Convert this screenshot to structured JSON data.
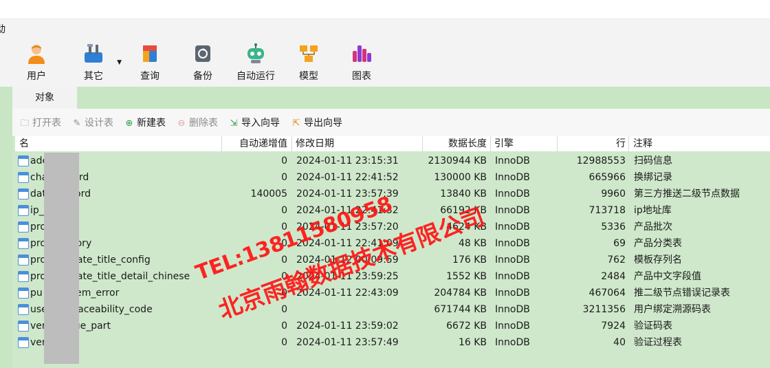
{
  "menubar": {
    "menu_label": "动"
  },
  "ribbon": [
    {
      "label": "用户",
      "icon": "user-icon"
    },
    {
      "label": "其它",
      "icon": "tools-icon"
    },
    {
      "label": "查询",
      "icon": "query-icon"
    },
    {
      "label": "备份",
      "icon": "backup-icon"
    },
    {
      "label": "自动运行",
      "icon": "robot-icon"
    },
    {
      "label": "模型",
      "icon": "model-icon"
    },
    {
      "label": "图表",
      "icon": "chart-icon"
    }
  ],
  "tabs": {
    "objects": "对象"
  },
  "toolbar": {
    "open_table": "打开表",
    "design_table": "设计表",
    "new_table": "新建表",
    "delete_table": "删除表",
    "import_wizard": "导入向导",
    "export_wizard": "导出向导"
  },
  "columns": {
    "name": "名",
    "auto_increment": "自动递增值",
    "modified": "修改日期",
    "data_length": "数据长度",
    "engine": "引擎",
    "rows": "行",
    "comment": "注释"
  },
  "rows": [
    {
      "name": "ade      nfo",
      "auto_inc": "0",
      "modified": "2024-01-11 23:15:31",
      "data_length": "2130944 KB",
      "engine": "InnoDB",
      "rows": "12988553",
      "comment": "扫码信息"
    },
    {
      "name": "cha         l_record",
      "auto_inc": "0",
      "modified": "2024-01-11 22:41:52",
      "data_length": "130000 KB",
      "engine": "InnoDB",
      "rows": "665966",
      "comment": "换绑记录"
    },
    {
      "name": "dat         n_record",
      "auto_inc": "140005",
      "modified": "2024-01-11 23:57:39",
      "data_length": "13840 KB",
      "engine": "InnoDB",
      "rows": "9960",
      "comment": "第三方推送二级节点数据"
    },
    {
      "name": "ip_",
      "auto_inc": "0",
      "modified": "2024-01-11 22:41:32",
      "data_length": "66192 KB",
      "engine": "InnoDB",
      "rows": "713718",
      "comment": "ip地址库"
    },
    {
      "name": "pro         batch",
      "auto_inc": "0",
      "modified": "2024-01-11 23:57:20",
      "data_length": "4624 KB",
      "engine": "InnoDB",
      "rows": "5336",
      "comment": "产品批次"
    },
    {
      "name": "pro         category",
      "auto_inc": "0",
      "modified": "2024-01-11 22:41:09",
      "data_length": "48 KB",
      "engine": "InnoDB",
      "rows": "69",
      "comment": "产品分类表"
    },
    {
      "name": "pro         template_title_config",
      "auto_inc": "0",
      "modified": "2024-01-12 00:09:59",
      "data_length": "176 KB",
      "engine": "InnoDB",
      "rows": "762",
      "comment": "模板存列名"
    },
    {
      "name": "pro         template_title_detail_chinese",
      "auto_inc": "0",
      "modified": "2024-01-11 23:59:25",
      "data_length": "1552 KB",
      "engine": "InnoDB",
      "rows": "2484",
      "comment": "产品中文字段值"
    },
    {
      "name": "pu          e_system_error",
      "auto_inc": "0",
      "modified": "2024-01-11 22:43:09",
      "data_length": "204784 KB",
      "engine": "InnoDB",
      "rows": "467064",
      "comment": "推二级节点错误记录表"
    },
    {
      "name": "use         ing_traceability_code",
      "auto_inc": "0",
      "modified": "",
      "data_length": "671744 KB",
      "engine": "InnoDB",
      "rows": "3211356",
      "comment": "用户绑定溯源码表"
    },
    {
      "name": "ver         n_value_part",
      "auto_inc": "0",
      "modified": "2024-01-11 23:59:02",
      "data_length": "6672 KB",
      "engine": "InnoDB",
      "rows": "7924",
      "comment": "验证码表"
    },
    {
      "name": "ver         r_time",
      "auto_inc": "0",
      "modified": "2024-01-11 23:57:49",
      "data_length": "16 KB",
      "engine": "InnoDB",
      "rows": "40",
      "comment": "验证过程表"
    }
  ],
  "watermark": {
    "tel": "TEL:13811580958",
    "company": "北京雨翰数据技术有限公司"
  },
  "colors": {
    "grid_bg": "#cfe8cb",
    "tab_bg": "#c8e6c4",
    "watermark": "#ff1414",
    "table_icon": "#4a90d9"
  }
}
